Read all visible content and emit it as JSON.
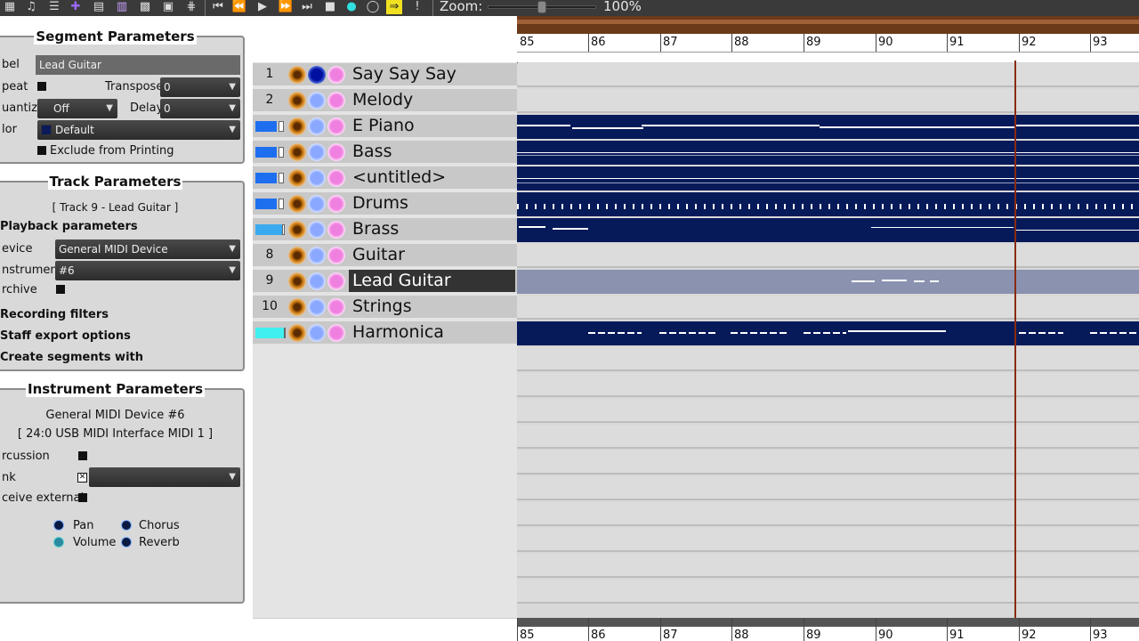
{
  "toolbar": {
    "icons": [
      "matrix-icon",
      "note-icon",
      "list-icon",
      "event-icon",
      "notation-icon",
      "piano-icon",
      "grid-icon",
      "mixer-icon",
      "fader-icon"
    ],
    "transport": [
      "rewind-to-start-icon",
      "rewind-icon",
      "play-icon",
      "fast-forward-icon",
      "end-icon",
      "stop-icon",
      "record-icon",
      "loop-icon",
      "follow-icon",
      "panic-icon"
    ],
    "zoom_label": "Zoom:",
    "zoom_value": "100%"
  },
  "segment_params": {
    "title": "Segment Parameters",
    "label_label": "bel",
    "label_value": "Lead Guitar",
    "repeat_label": "peat",
    "transpose_label": "Transpose",
    "transpose_value": "0",
    "quantize_label": "uantize",
    "quantize_value": "Off",
    "delay_label": "Delay",
    "delay_value": "0",
    "color_label": "lor",
    "color_value": "Default",
    "exclude_label": "Exclude from Printing"
  },
  "track_params": {
    "title": "Track Parameters",
    "track_info": "[ Track 9 - Lead Guitar ]",
    "playback_label": "Playback parameters",
    "device_label": "evice",
    "device_value": "General MIDI Device",
    "instrument_label": "nstrument",
    "instrument_value": "#6",
    "archive_label": "rchive",
    "recording_filters": "Recording filters",
    "staff_export": "Staff export options",
    "create_segments": "Create segments with"
  },
  "instrument_params": {
    "title": "Instrument Parameters",
    "device_line": "General MIDI Device  #6",
    "port_line": "[ 24:0 USB MIDI Interface MIDI 1 ]",
    "percussion_label": "rcussion",
    "bank_label": "nk",
    "receive_label": "ceive external",
    "pan_label": "Pan",
    "chorus_label": "Chorus",
    "volume_label": "Volume",
    "reverb_label": "Reverb"
  },
  "tracks": [
    {
      "num": "1",
      "name": "Say Say Say"
    },
    {
      "num": "2",
      "name": "Melody"
    },
    {
      "num": "",
      "name": "E Piano"
    },
    {
      "num": "",
      "name": "Bass"
    },
    {
      "num": "",
      "name": "<untitled>"
    },
    {
      "num": "",
      "name": "Drums"
    },
    {
      "num": "",
      "name": "Brass"
    },
    {
      "num": "8",
      "name": "Guitar"
    },
    {
      "num": "9",
      "name": "Lead Guitar"
    },
    {
      "num": "10",
      "name": "Strings"
    },
    {
      "num": "",
      "name": "Harmonica"
    }
  ],
  "ruler": {
    "bars": [
      "85",
      "86",
      "87",
      "88",
      "89",
      "90",
      "91",
      "92",
      "93"
    ]
  },
  "colors": {
    "segment": "#061a5a",
    "selected_segment": "#8a92b0",
    "playhead": "#8a2a10",
    "meter_blue": "#1e6ff0",
    "meter_lightblue": "#3aaaf0",
    "meter_cyan": "#40f0f0"
  }
}
